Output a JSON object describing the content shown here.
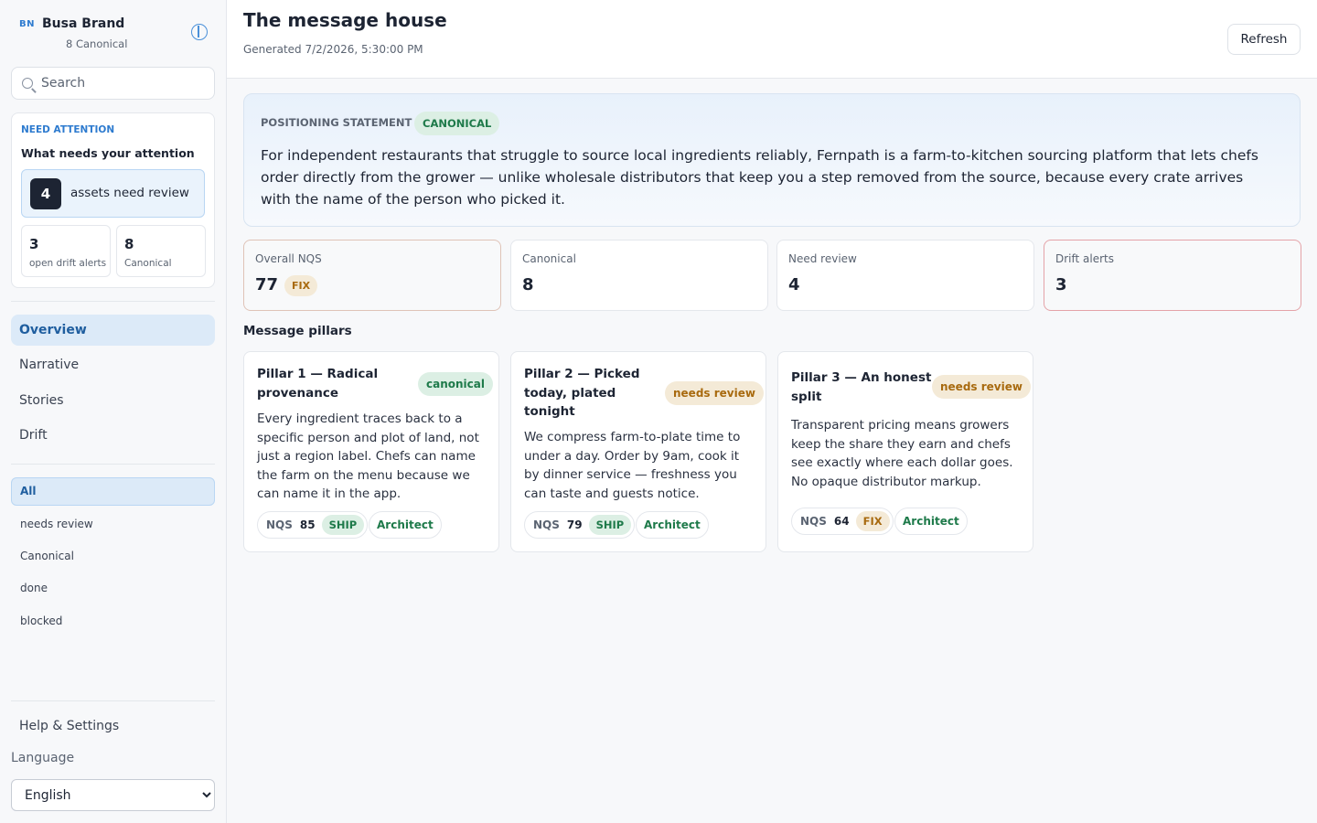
{
  "brand": {
    "mark": "BN",
    "name": "Busa Brand",
    "subtitle": "8 Canonical"
  },
  "search": {
    "placeholder": "Search"
  },
  "attention": {
    "kicker": "NEED ATTENTION",
    "title": "What needs your attention",
    "review_count": "4",
    "review_label": "assets need review",
    "drift_count": "3",
    "drift_label": "open drift alerts",
    "canonical_count": "8",
    "canonical_label": "Canonical"
  },
  "nav": {
    "items": [
      {
        "label": "Overview",
        "active": true
      },
      {
        "label": "Narrative"
      },
      {
        "label": "Stories"
      },
      {
        "label": "Drift"
      }
    ]
  },
  "filters": {
    "items": [
      {
        "label": "All",
        "active": true
      },
      {
        "label": "needs review"
      },
      {
        "label": "Canonical"
      },
      {
        "label": "done"
      },
      {
        "label": "blocked"
      }
    ]
  },
  "footer": {
    "help_label": "Help & Settings",
    "language_label": "Language",
    "language_value": "English"
  },
  "header": {
    "title": "The message house",
    "generated": "Generated 7/2/2026, 5:30:00 PM",
    "refresh_label": "Refresh"
  },
  "positioning": {
    "kicker": "POSITIONING STATEMENT",
    "badge": "CANONICAL",
    "text": "For independent restaurants that struggle to source local ingredients reliably, Fernpath is a farm-to-kitchen sourcing platform that lets chefs order directly from the grower — unlike wholesale distributors that keep you a step removed from the source, because every crate arrives with the name of the person who picked it."
  },
  "kpis": [
    {
      "label": "Overall NQS",
      "value": "77",
      "badge": "FIX"
    },
    {
      "label": "Canonical",
      "value": "8"
    },
    {
      "label": "Need review",
      "value": "4"
    },
    {
      "label": "Drift alerts",
      "value": "3"
    }
  ],
  "pillars_section": {
    "title": "Message pillars"
  },
  "pillars": [
    {
      "title": "Pillar 1 — Radical provenance",
      "status": "canonical",
      "body": "Every ingredient traces back to a specific person and plot of land, not just a region label. Chefs can name the farm on the menu because we can name it in the app.",
      "nqs_label": "NQS",
      "nqs": "85",
      "verdict": "SHIP",
      "role": "Architect"
    },
    {
      "title": "Pillar 2 — Picked today, plated tonight",
      "status": "needs review",
      "body": "We compress farm-to-plate time to under a day. Order by 9am, cook it by dinner service — freshness you can taste and guests notice.",
      "nqs_label": "NQS",
      "nqs": "79",
      "verdict": "SHIP",
      "role": "Architect"
    },
    {
      "title": "Pillar 3 — An honest split",
      "status": "needs review",
      "body": "Transparent pricing means growers keep the share they earn and chefs see exactly where each dollar goes. No opaque distributor markup.",
      "nqs_label": "NQS",
      "nqs": "64",
      "verdict": "FIX",
      "role": "Architect"
    }
  ],
  "colors": {
    "accent": "#2e7bcf",
    "canonical_green": "#1e7a4a",
    "review_amber": "#a86a0f",
    "drift_red": "#e4a3a8"
  }
}
